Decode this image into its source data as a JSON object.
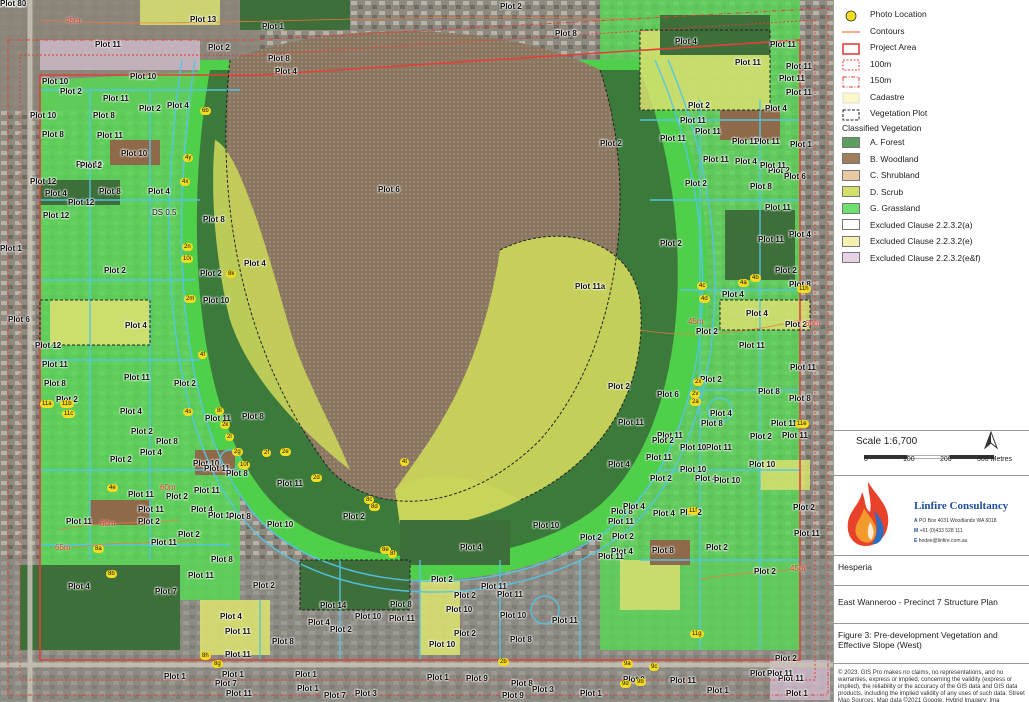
{
  "map": {
    "plot_labels": [
      "Plot 13",
      "Plot 2",
      "Plot 11",
      "Plot 2",
      "Plot 1",
      "Plot 8",
      "Plot 4",
      "Plot 8",
      "Plot 4",
      "Plot 11",
      "Plot 11",
      "Plot 10",
      "Plot 10",
      "Plot 2",
      "Plot 11",
      "Plot 2",
      "Plot 4",
      "Plot 8",
      "Plot 10",
      "Plot 11",
      "Plot 10",
      "Plot 8",
      "Plot 10",
      "Plot 2",
      "Plot 12",
      "Plot 4",
      "Plot 8",
      "Plot 4",
      "Plot 12",
      "Plot 12",
      "Plot 8",
      "Plot 6",
      "Plot 2",
      "Plot 4",
      "Plot 2",
      "Plot 10",
      "Plot 6",
      "Plot 4",
      "Plot 12",
      "Plot 11",
      "Plot 11",
      "Plot 2",
      "Plot 4",
      "Plot 8",
      "Plot 2",
      "Plot 8",
      "Plot 4",
      "Plot 10",
      "Plot 2",
      "Plot 11",
      "Plot 11",
      "Plot 8",
      "Plot 11",
      "Plot 2",
      "Plot 11",
      "Plot 11",
      "Plot 4",
      "Plot 2",
      "Plot 10",
      "Plot 8",
      "Plot 10",
      "Plot 11",
      "Plot 2",
      "Plot 11",
      "Plot 2",
      "Plot 8",
      "Plot 11",
      "Plot 2",
      "Plot 4",
      "Plot 11",
      "Plot 4",
      "Plot 7",
      "Plot 8",
      "Plot 11",
      "Plot 14",
      "Plot 4",
      "Plot 2",
      "Plot 10",
      "Plot 8",
      "Plot 11",
      "Plot 10",
      "Plot 2",
      "Plot 10",
      "Plot 4",
      "Plot 2",
      "Plot 11",
      "Plot 11",
      "Plot 2",
      "Plot 10",
      "Plot 8",
      "Plot 11",
      "Plot 10",
      "Plot 2",
      "Plot 8",
      "Plot 11",
      "Plot 4",
      "Plot 2",
      "Plot 4",
      "Plot 4",
      "Plot 8",
      "Plot 11",
      "Plot 2",
      "Plot 2",
      "Plot 2",
      "Plot 2",
      "Plot 11",
      "Plot 4",
      "Plot 10",
      "Plot 2",
      "Plot 4",
      "Plot 11",
      "Plot 10",
      "Plot 11",
      "Plot 10",
      "Plot 11",
      "Plot 8",
      "Plot 2",
      "Plot 4",
      "Plot 11",
      "Plot 11",
      "Plot 6",
      "Plot 2",
      "Plot 8",
      "Plot 11",
      "Plot 11",
      "Plot 2",
      "Plot 4",
      "Plot 2",
      "Plot 4",
      "Plot 2",
      "Plot 2",
      "Plot 11",
      "Plot 11",
      "Plot 8",
      "Plot 2",
      "Plot 4",
      "Plot 11",
      "Plot 2",
      "Plot 11",
      "Plot 11",
      "Plot 2",
      "Plot 4",
      "Plot 11",
      "Plot 11",
      "Plot 11",
      "Plot 1",
      "Plot 1",
      "Plot 7",
      "Plot 11",
      "Plot 1",
      "Plot 1",
      "Plot 7",
      "Plot 3",
      "Plot 1",
      "Plot 9",
      "Plot 8",
      "Plot 9",
      "Plot 3",
      "Plot 1",
      "Plot 0",
      "Plot 11",
      "Plot 1",
      "Plot 9",
      "Plot 11",
      "Plot 1",
      "Plot 1",
      "Plot 11a",
      "Plot 2",
      "Plot 10",
      "Plot 8",
      "Plot 11",
      "Plot 2",
      "Plot 11",
      "Plot 6",
      "Plot 4",
      "Plot 8",
      "Plot 11",
      "Plot 2",
      "Plot 11",
      "Plot 2",
      "Plot 11",
      "Plot 11",
      "Plot 1",
      "Plot 8",
      "Plot 2",
      "Plot 11",
      "Plot 2",
      "Plot 12",
      "Plot 10",
      "Plot 8"
    ],
    "contour_labels": [
      "45m",
      "45m",
      "45m",
      "65m",
      "60m",
      "60m",
      "60m"
    ],
    "photo_tags": [
      "6b",
      "4y",
      "4x",
      "2n",
      "10i",
      "2m",
      "8k",
      "4f",
      "8l",
      "4s",
      "2k",
      "2l",
      "2g",
      "10f",
      "2f",
      "2e",
      "2d",
      "4t",
      "2v",
      "4c",
      "4d",
      "4a",
      "4b",
      "2a",
      "8a",
      "8b",
      "9a",
      "9b",
      "9d",
      "9c",
      "11a",
      "11b",
      "11c",
      "11e",
      "11f",
      "11g",
      "11h",
      "4e",
      "2x",
      "8c",
      "8d",
      "8e",
      "8f",
      "8h",
      "8g",
      "2b"
    ],
    "label_text_ds": "DS 0.5"
  },
  "legend": {
    "items": [
      {
        "label": "Photo Location",
        "symbol": "photo"
      },
      {
        "label": "Contours",
        "symbol": "contour"
      },
      {
        "label": "Project Area",
        "symbol": "project"
      },
      {
        "label": "100m",
        "symbol": "buffer100"
      },
      {
        "label": "150m",
        "symbol": "buffer150"
      },
      {
        "label": "Cadastre",
        "symbol": "cadastre"
      },
      {
        "label": "Vegetation Plot",
        "symbol": "vegplot"
      }
    ],
    "heading": "Classified Vegetation",
    "veg_items": [
      {
        "label": "A. Forest",
        "color": "#5d9e5f"
      },
      {
        "label": "B. Woodland",
        "color": "#a07d5c"
      },
      {
        "label": "C. Shrubland",
        "color": "#e8c9a1"
      },
      {
        "label": "D. Scrub",
        "color": "#d3e06a"
      },
      {
        "label": "G. Grassland",
        "color": "#6de06f"
      },
      {
        "label": "Excluded Clause 2.2.3.2(a)",
        "color": "#ffffff"
      },
      {
        "label": "Excluded Clause 2.2.3.2(e)",
        "color": "#f5f0b0"
      },
      {
        "label": "Excluded Clause 2.2.3.2(e&f)",
        "color": "#e8d2e6"
      }
    ],
    "photo_marker_letter": "A"
  },
  "scale": {
    "title": "Scale 1:6,700",
    "ticks": [
      "0",
      "100",
      "200",
      "300 Metres"
    ]
  },
  "company": {
    "name": "Linfire Consultancy",
    "address_key": "A",
    "address": "PO Box 4031 Woodlands WA 6018",
    "mobile_key": "M",
    "mobile": "+61 (0)433 528 111",
    "email_key": "E",
    "email": "hodee@linfire.com.au"
  },
  "info": {
    "client": "Hesperia",
    "project": "East Wanneroo - Precinct 7 Structure Plan",
    "figure": "Figure 3: Pre-development Vegetation and Effective Slope (West)",
    "disclaimer": "© 2023. GIS Pro makes no claims, no representations, and no warranties, express or implied, concerning the validity (express or implied), the reliability or the accuracy of the GIS data and GIS data products, including the implied validity of any uses of such data. Street Map Sources: Map data ©2021 Google. Hybrid Imagery: Ima"
  },
  "colors": {
    "forest": "#3c7a3c",
    "woodland": "#8a7660",
    "scrub": "#c9d45a",
    "grassland": "#57d855",
    "cadastre": "#53c6e6",
    "project_area": "#e0413a",
    "contour": "#f07a3a"
  }
}
